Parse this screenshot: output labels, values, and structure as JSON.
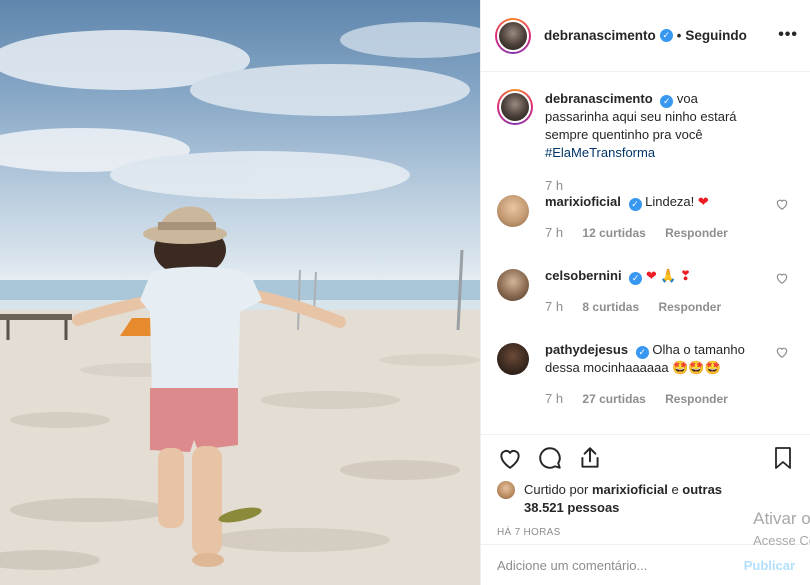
{
  "post": {
    "author": "debranascimento",
    "follow_status": "Seguindo",
    "more_icon": "more-horizontal-icon",
    "photo_description_icon": "post-photo"
  },
  "caption": {
    "username": "debranascimento",
    "text": "voa passarinha aqui seu ninho estará sempre quentinho pra você",
    "hashtag": "#ElaMeTransforma",
    "time": "7 h"
  },
  "comments": [
    {
      "username": "marixioficial",
      "verified": true,
      "text": "Lindeza! ",
      "emoji": "❤",
      "time": "7 h",
      "likes": "12 curtidas",
      "reply": "Responder"
    },
    {
      "username": "celsobernini",
      "verified": true,
      "text": "",
      "emoji": "❤ 🙏 ❣",
      "time": "7 h",
      "likes": "8 curtidas",
      "reply": "Responder"
    },
    {
      "username": "pathydejesus",
      "verified": true,
      "text": "Olha o tamanho dessa mocinhaaaaaa ",
      "emoji": "🤩🤩🤩",
      "time": "7 h",
      "likes": "27 curtidas",
      "reply": "Responder"
    }
  ],
  "likes": {
    "prefix": "Curtido por",
    "by_user": "marixioficial",
    "and": "e",
    "others": "outras 38.521 pessoas"
  },
  "post_time": "HÁ 7 HORAS",
  "add_comment": {
    "placeholder": "Adicione um comentário...",
    "publish_label": "Publicar"
  },
  "watermark": {
    "line1": "Ativar o",
    "line2": "Acesse Co"
  },
  "colors": {
    "verified": "#3897f0",
    "hashtag": "#003569",
    "publish_disabled": "#b2dffc",
    "muted": "#8e8e8e"
  }
}
